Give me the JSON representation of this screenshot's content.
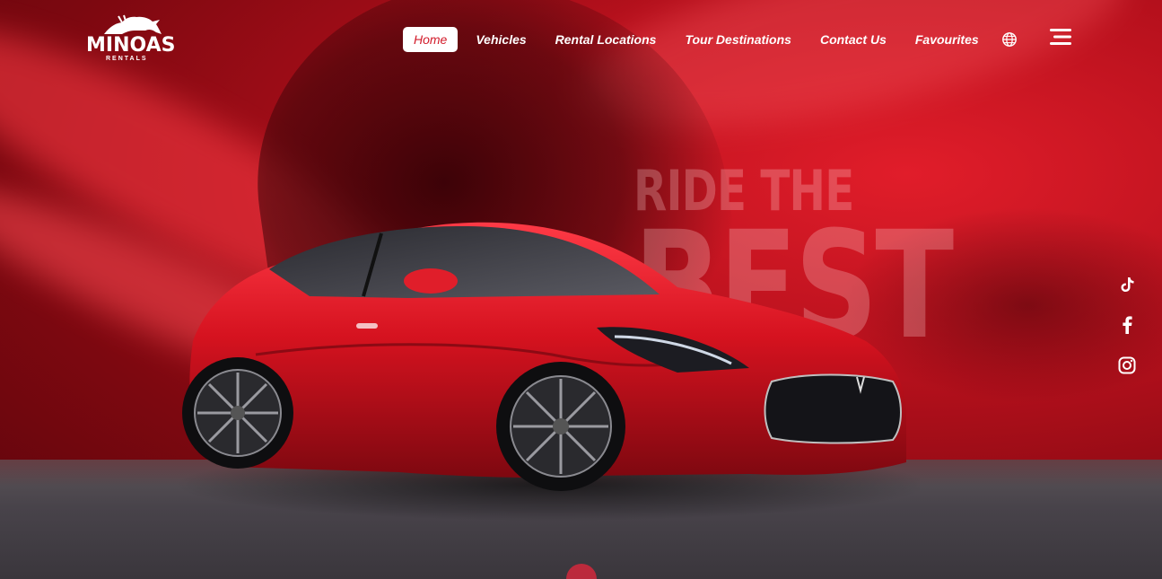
{
  "brand": {
    "name": "MINOAS",
    "sub": "RENTALS"
  },
  "nav": {
    "items": [
      {
        "label": "Home"
      },
      {
        "label": "Vehicles"
      },
      {
        "label": "Rental Locations"
      },
      {
        "label": "Tour Destinations"
      },
      {
        "label": "Contact Us"
      },
      {
        "label": "Favourites"
      }
    ],
    "active_index": 0,
    "globe_icon": "globe-icon",
    "menu_icon": "hamburger-menu-icon"
  },
  "hero": {
    "headline_line1": "RIDE THE",
    "headline_line2": "BEST"
  },
  "social": {
    "icons": [
      "tiktok-icon",
      "facebook-icon",
      "instagram-icon"
    ]
  },
  "colors": {
    "accent": "#d21b2a",
    "background_red": "#b5101c",
    "floor_gray": "#48434a",
    "text": "#ffffff"
  }
}
